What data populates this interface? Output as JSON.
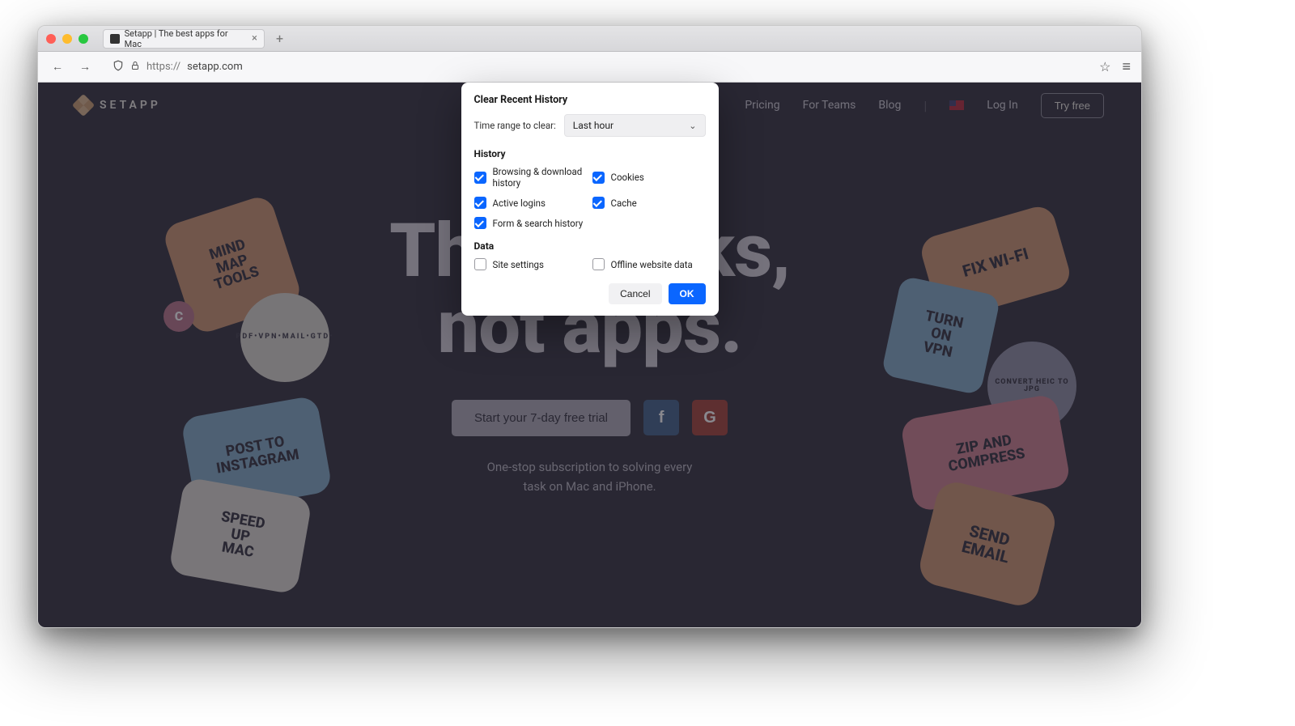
{
  "browser": {
    "tab_title": "Setapp | The best apps for Mac",
    "url_prefix": "https://",
    "url_rest": "setapp.com"
  },
  "site": {
    "brand": "SETAPP",
    "nav": {
      "pricing": "Pricing",
      "teams": "For Teams",
      "blog": "Blog",
      "login": "Log In"
    },
    "try_free": "Try free",
    "hero_line1": "Think tasks,",
    "hero_line2": "not apps.",
    "cta": "Start your 7-day free trial",
    "sub_line1": "One-stop subscription to solving every",
    "sub_line2": "task on Mac and iPhone.",
    "badges": {
      "mindmap": "MIND\nMAP\nTOOLS",
      "c": "C",
      "circle1": "PDF•VPN•MAIL•GTD•",
      "post": "POST TO\nINSTAGRAM",
      "speed": "SPEED\nUP\nMAC",
      "wifi": "FIX WI-FI",
      "vpn": "TURN\nON\nVPN",
      "heic": "CONVERT HEIC TO JPG",
      "zip": "ZIP AND\nCOMPRESS",
      "email": "SEND\nEMAIL"
    }
  },
  "dialog": {
    "title": "Clear Recent History",
    "range_label": "Time range to clear:",
    "range_value": "Last hour",
    "section_history": "History",
    "section_data": "Data",
    "items": {
      "browsing": "Browsing & download history",
      "cookies": "Cookies",
      "active": "Active logins",
      "cache": "Cache",
      "form": "Form & search history",
      "sitesettings": "Site settings",
      "offline": "Offline website data"
    },
    "cancel": "Cancel",
    "ok": "OK"
  }
}
